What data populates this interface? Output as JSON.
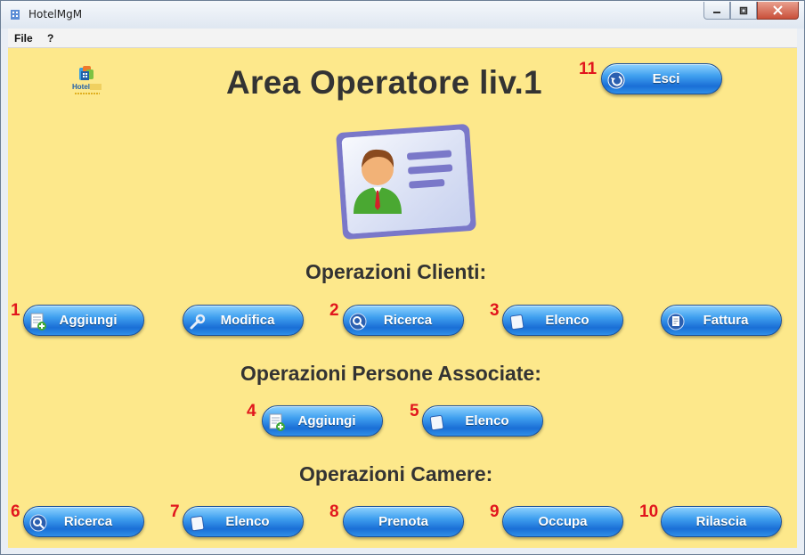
{
  "window": {
    "title": "HotelMgM"
  },
  "menu": {
    "file": "File",
    "help": "?"
  },
  "header": {
    "title": "Area Operatore liv.1",
    "logo_text": "Hotel"
  },
  "exit": {
    "label": "Esci",
    "num": "11"
  },
  "clients": {
    "title": "Operazioni Clienti:",
    "buttons": [
      {
        "label": "Aggiungi",
        "num": "1"
      },
      {
        "label": "Modifica",
        "num": ""
      },
      {
        "label": "Ricerca",
        "num": "2"
      },
      {
        "label": "Elenco",
        "num": "3"
      },
      {
        "label": "Fattura",
        "num": ""
      }
    ]
  },
  "associates": {
    "title": "Operazioni Persone Associate:",
    "buttons": [
      {
        "label": "Aggiungi",
        "num": "4"
      },
      {
        "label": "Elenco",
        "num": "5"
      }
    ]
  },
  "rooms": {
    "title": "Operazioni Camere:",
    "buttons": [
      {
        "label": "Ricerca",
        "num": "6"
      },
      {
        "label": "Elenco",
        "num": "7"
      },
      {
        "label": "Prenota",
        "num": "8"
      },
      {
        "label": "Occupa",
        "num": "9"
      },
      {
        "label": "Rilascia",
        "num": "10"
      }
    ]
  }
}
